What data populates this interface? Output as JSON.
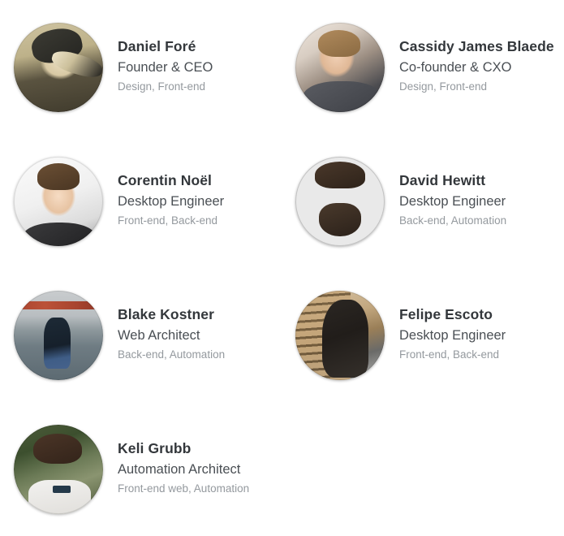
{
  "page": {
    "title": "Team Members",
    "background_color": "#ffffff",
    "name_color": "#33373b",
    "role_color": "#4a4f54",
    "tags_color": "#94999e"
  },
  "team": {
    "members": [
      {
        "name": "Daniel Foré",
        "role": "Founder & CEO",
        "tags": "Design, Front-end",
        "avatar": "avatar-daniel-fore"
      },
      {
        "name": "Cassidy James Blaede",
        "role": "Co-founder & CXO",
        "tags": "Design, Front-end",
        "avatar": "avatar-cassidy-james-blaede"
      },
      {
        "name": "Corentin Noël",
        "role": "Desktop Engineer",
        "tags": "Front-end, Back-end",
        "avatar": "avatar-corentin-noel"
      },
      {
        "name": "David Hewitt",
        "role": "Desktop Engineer",
        "tags": "Back-end, Automation",
        "avatar": "avatar-david-hewitt"
      },
      {
        "name": "Blake Kostner",
        "role": "Web Architect",
        "tags": "Back-end, Automation",
        "avatar": "avatar-blake-kostner"
      },
      {
        "name": "Felipe Escoto",
        "role": "Desktop Engineer",
        "tags": "Front-end, Back-end",
        "avatar": "avatar-felipe-escoto"
      },
      {
        "name": "Keli Grubb",
        "role": "Automation Architect",
        "tags": "Front-end web, Automation",
        "avatar": "avatar-keli-grubb"
      }
    ]
  }
}
